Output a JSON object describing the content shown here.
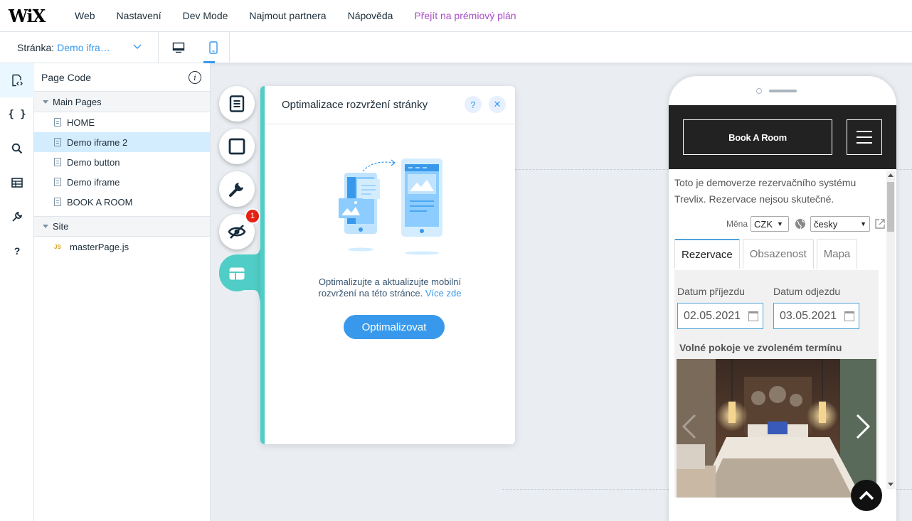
{
  "topbar": {
    "logo": "WiX",
    "menu": [
      "Web",
      "Nastavení",
      "Dev Mode",
      "Najmout partnera",
      "Nápověda"
    ],
    "premium": "Přejít na prémiový plán"
  },
  "subbar": {
    "page_label": "Stránka:",
    "page_value": "Demo ifra…"
  },
  "code_panel": {
    "title": "Page Code",
    "main_pages_label": "Main Pages",
    "pages": [
      "HOME",
      "Demo iframe 2",
      "Demo button",
      "Demo iframe",
      "BOOK A ROOM"
    ],
    "selected_page": "Demo iframe 2",
    "site_label": "Site",
    "site_files": [
      "masterPage.js"
    ],
    "js_badge": "JS"
  },
  "tools": {
    "badge_count": "1"
  },
  "opt_panel": {
    "title": "Optimalizace rozvržení stránky",
    "help": "?",
    "close": "✕",
    "text_line1": "Optimalizujte a aktualizujte mobilní",
    "text_line2": "rozvržení na této stránce.",
    "link": "Více zde",
    "button": "Optimalizovat"
  },
  "phone": {
    "book_button": "Book A Room",
    "intro": "Toto je demoverze rezervačního systému Trevlix. Rezervace nejsou skutečné.",
    "currency_label": "Měna",
    "currency_value": "CZK",
    "language_value": "česky",
    "tabs": [
      "Rezervace",
      "Obsazenost",
      "Mapa"
    ],
    "arrival_label": "Datum příjezdu",
    "arrival_value": "02.05.2021",
    "departure_label": "Datum odjezdu",
    "departure_value": "03.05.2021",
    "free_rooms": "Volné pokoje ve zvoleném termínu"
  },
  "colors": {
    "accent_blue": "#3899ec",
    "teal": "#4fcdc6",
    "premium_purple": "#aa4dc8",
    "badge_red": "#e62214"
  }
}
